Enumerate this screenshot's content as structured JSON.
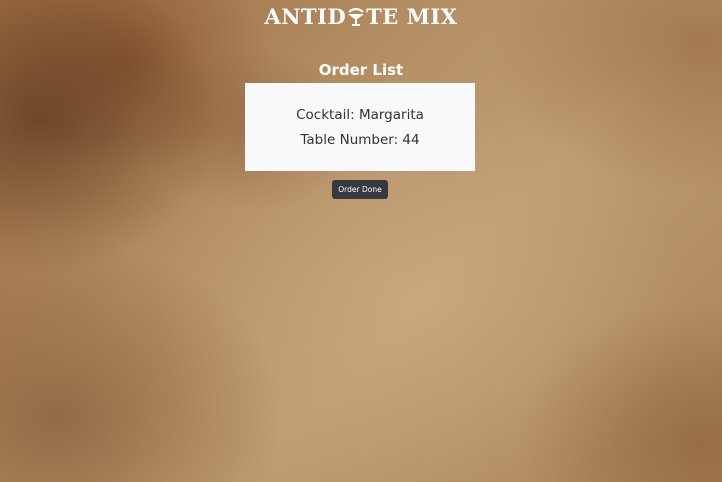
{
  "header": {
    "brand_left": "ANTID",
    "brand_right": "TE MIX",
    "brand_glass_icon": "cocktail-glass-icon"
  },
  "main": {
    "title": "Order List",
    "order": {
      "cocktail": "Cocktail: Margarita",
      "table": "Table Number: 44"
    },
    "done_button_label": "Order Done"
  },
  "colors": {
    "card_background": "#f8f9fb",
    "button_background": "#343a40",
    "text_white": "#ffffff"
  }
}
